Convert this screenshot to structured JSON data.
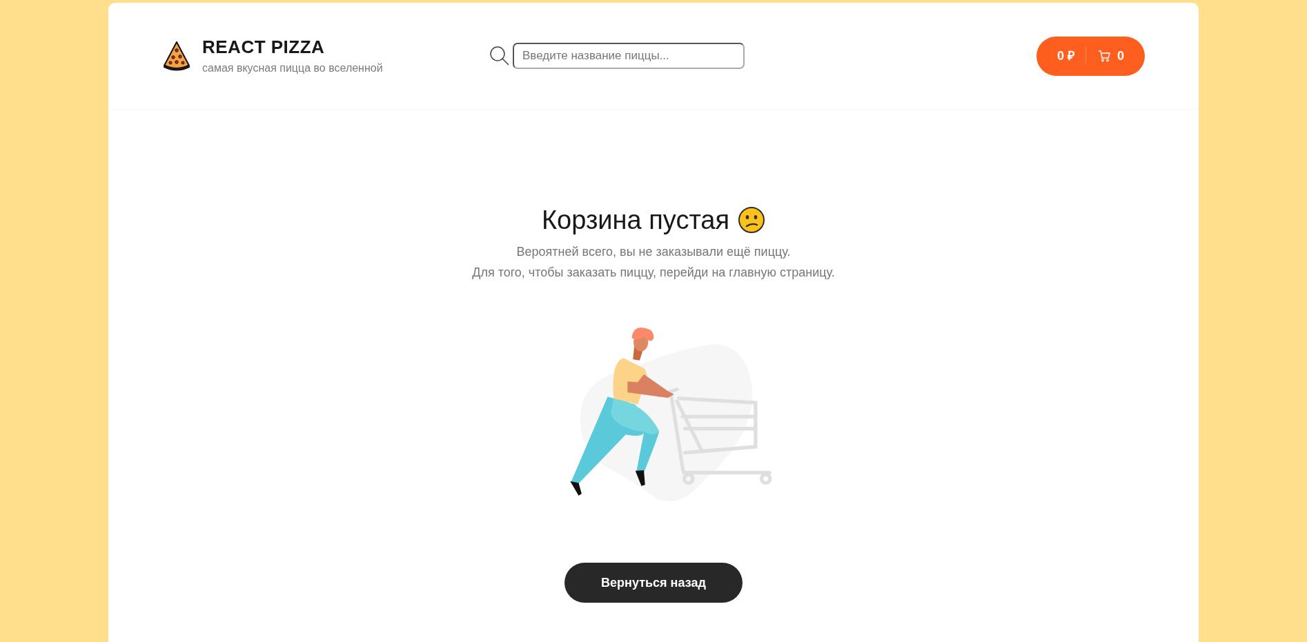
{
  "header": {
    "logo": {
      "title": "REACT PIZZA",
      "subtitle": "самая вкусная пицца во вселенной"
    },
    "search": {
      "placeholder": "Введите название пиццы..."
    },
    "cart_button": {
      "total": "0 ₽",
      "count": "0"
    }
  },
  "empty_cart": {
    "title": "Корзина пустая",
    "lines": [
      "Вероятней всего, вы не заказывали ещё пиццу.",
      "Для того, чтобы заказать пиццу, перейди на главную страницу."
    ],
    "back_button": "Вернуться назад"
  }
}
